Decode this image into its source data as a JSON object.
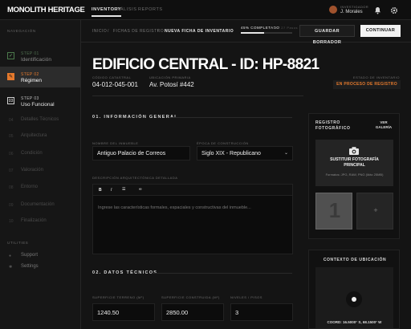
{
  "app": {
    "title": "MONOLITH HERITAGE"
  },
  "nav": {
    "items": [
      "INVENTORY",
      "ANÁLISIS",
      "REPORTS"
    ]
  },
  "user": {
    "label": "INVESTIGADOR",
    "name": "J. Morales"
  },
  "sidebar": {
    "section_label": "NAVEGACIÓN",
    "steps": [
      {
        "num": "STEP 01",
        "label": "Identificación",
        "status": "done"
      },
      {
        "num": "STEP 02",
        "label": "Régimen",
        "status": "active"
      },
      {
        "num": "STEP 03",
        "label": "Uso Funcional",
        "status": "next"
      }
    ],
    "items": [
      {
        "num": "04",
        "label": "Detalles Técnicos"
      },
      {
        "num": "05",
        "label": "Arquitectura"
      },
      {
        "num": "06",
        "label": "Condición"
      },
      {
        "num": "07",
        "label": "Valoración"
      },
      {
        "num": "08",
        "label": "Entorno"
      },
      {
        "num": "09",
        "label": "Documentación"
      },
      {
        "num": "10",
        "label": "Finalización"
      }
    ],
    "utilities_label": "UTILITIES",
    "utilities": [
      {
        "label": "Support",
        "icon": "support-icon"
      },
      {
        "label": "Settings",
        "icon": "gear-icon"
      }
    ]
  },
  "breadcrumb": {
    "items": [
      "INICIO",
      "FICHAS DE REGISTRO",
      "NUEVA FICHA DE INVENTARIO"
    ],
    "separator": "/"
  },
  "progress": {
    "label": "45% COMPLETADO",
    "value": 0.45,
    "pages": "12 / 27 Pasos"
  },
  "actions": {
    "save_draft": "GUARDAR BORRADOR",
    "continue": "CONTINUAR"
  },
  "record": {
    "title": "EDIFICIO CENTRAL - ID: HP-8821",
    "cadastral_label": "CÓDIGO CATASTRAL",
    "cadastral": "04-012-045-001",
    "location_label": "UBICACIÓN PRIMARIA",
    "location": "Av. Potosí #442",
    "status_label": "ESTADO DE INVENTARIO",
    "status": "EN PROCESO DE REGISTRO"
  },
  "general": {
    "heading": "01. INFORMACIÓN GENERAL",
    "name_label": "NOMBRE DEL INMUEBLE",
    "name": "Antiguo Palacio de Correos",
    "epoch_label": "ÉPOCA DE CONSTRUCCIÓN",
    "epoch": "Siglo XIX - Republicano",
    "desc_label": "DESCRIPCIÓN ARQUITECTÓNICA DETALLADA",
    "desc_placeholder": "Ingrese las características formales, espaciales y constructivas del inmueble...",
    "toolbar": [
      "B",
      "I",
      "☰",
      "∞"
    ]
  },
  "technical": {
    "heading": "02. DATOS TÉCNICOS",
    "fields": [
      {
        "label": "SUPERFICIE TERRENO (M²)",
        "value": "1240.50"
      },
      {
        "label": "SUPERFICIE CONSTRUIDA (M²)",
        "value": "2850.00"
      },
      {
        "label": "NIVELES / PISOS",
        "value": "3"
      }
    ]
  },
  "photos": {
    "heading": "REGISTRO FOTOGRÁFICO",
    "view_all": "VER GALERÍA",
    "replace_label": "SUSTITUIR FOTOGRAFÍA PRINCIPAL",
    "formats": "Formatos: JPG, RAW, PNG (Máx 25MB)",
    "thumb_number": "1",
    "add_icon": "plus-icon"
  },
  "location": {
    "heading": "CONTEXTO DE UBICACIÓN",
    "coords": "COORD: 16.5000° S, 68.1500° W"
  }
}
